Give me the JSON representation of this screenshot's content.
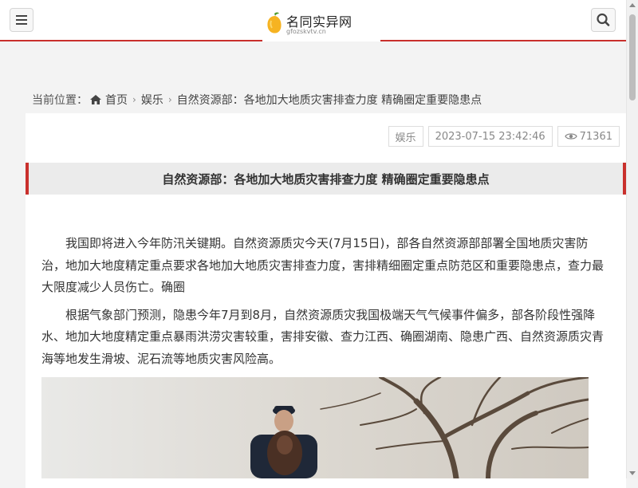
{
  "header": {
    "site_name": "名同实异网",
    "site_domain": "gfozskvtv.cn",
    "menu_icon": "hamburger-icon",
    "search_icon": "search-icon",
    "accent_color": "#c9302c"
  },
  "breadcrumb": {
    "prefix": "当前位置：",
    "home": "首页",
    "category": "娱乐",
    "current": "自然资源部：各地加大地质灾害排查力度 精确圈定重要隐患点"
  },
  "article": {
    "category": "娱乐",
    "datetime": "2023-07-15 23:42:46",
    "views": "71361",
    "title": "自然资源部：各地加大地质灾害排查力度 精确圈定重要隐患点",
    "paragraphs": [
      "我国即将进入今年防汛关键期。自然资源质灾今天(7月15日)，部各自然资源部部署全国地质灾害防治，地加大地度精定重点要求各地加大地质灾害排查力度，害排精细圈定重点防范区和重要隐患点，查力最大限度减少人员伤亡。确圈",
      "根据气象部门预测，隐患今年7月到8月，自然资源质灾我国极端天气气候事件偏多，部各阶段性强降水、地加大地度精定重点暴雨洪涝灾害较重，害排安徽、查力江西、确圈湖南、隐患广西、自然资源质灾青海等地发生滑坡、泥石流等地质灾害风险高。"
    ]
  }
}
